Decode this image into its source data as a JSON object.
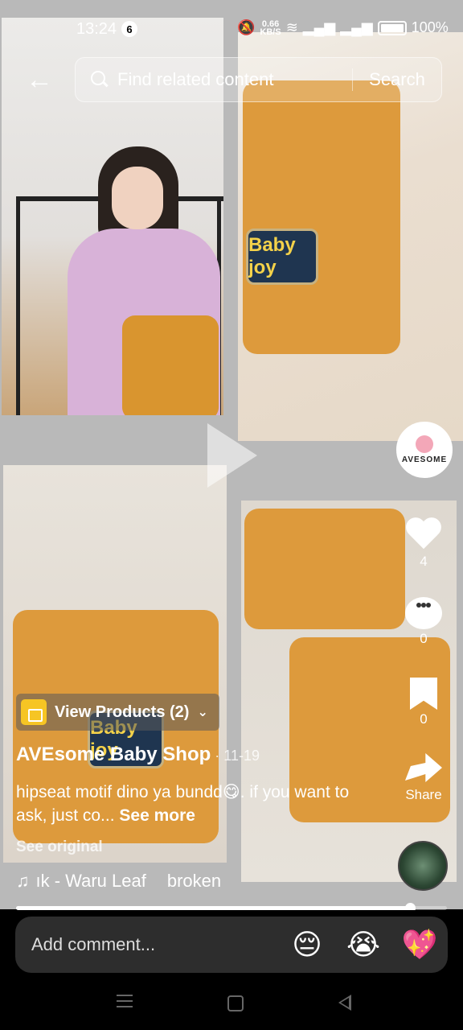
{
  "status_bar": {
    "time": "13:24",
    "notification_count": "6",
    "net_speed_value": "0.66",
    "net_speed_unit": "KB/S",
    "battery": "100%"
  },
  "search": {
    "placeholder": "Find related content",
    "button_label": "Search"
  },
  "video": {
    "badge_text": "Baby joy",
    "progress": 0.915
  },
  "creator": {
    "avatar_text": "AVESOME",
    "username": "AVEsome Baby Shop",
    "date": " · 11-19"
  },
  "actions": {
    "likes": "4",
    "comments": "0",
    "saves": "0",
    "share_label": "Share"
  },
  "products": {
    "label": "View Products (2)"
  },
  "caption": {
    "text": "hipseat motif dino ya bundd😋. if you want to ask, just co...",
    "see_more": "See more",
    "see_original": "See original"
  },
  "music": {
    "note": "♫",
    "title": "ık - Waru Leaf",
    "extra": "broken"
  },
  "comment_bar": {
    "placeholder": "Add comment...",
    "emojis": [
      "😔",
      "😭",
      "💖"
    ]
  }
}
